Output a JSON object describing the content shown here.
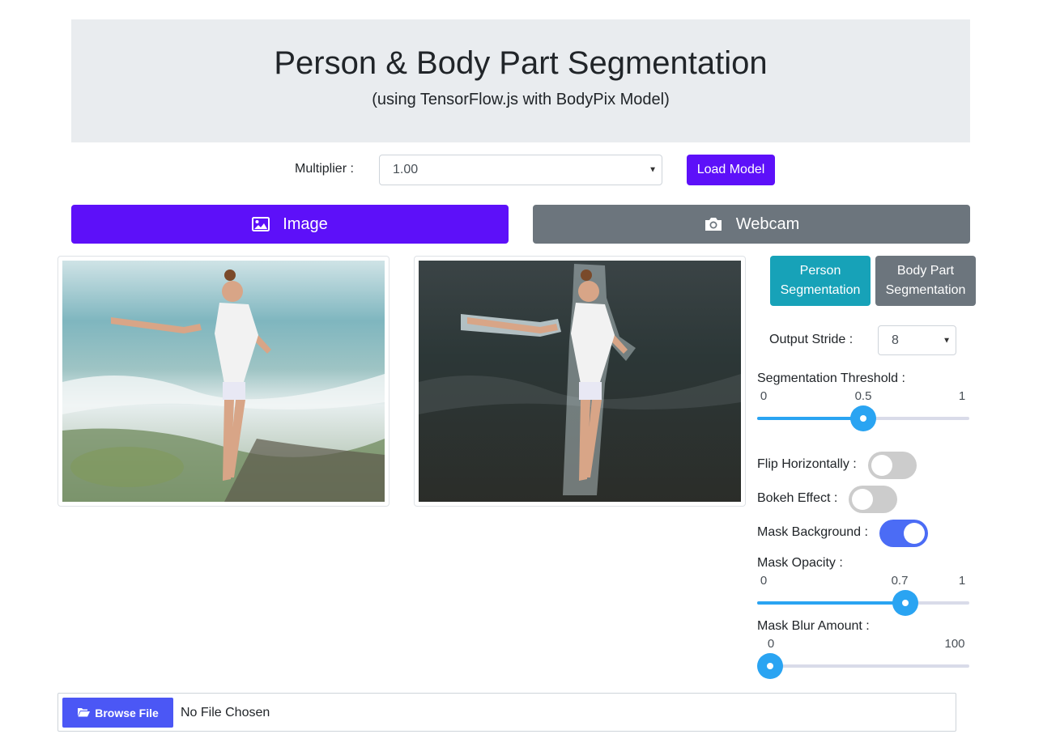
{
  "header": {
    "title": "Person & Body Part Segmentation",
    "subtitle": "(using TensorFlow.js with BodyPix Model)"
  },
  "model": {
    "multiplier_label": "Multiplier :",
    "multiplier_value": "1.00",
    "load_button": "Load Model"
  },
  "tabs": [
    {
      "label": "Image",
      "icon": "image-icon",
      "active": true
    },
    {
      "label": "Webcam",
      "icon": "camera-icon",
      "active": false
    }
  ],
  "segmentation_modes": {
    "person": "Person\nSegmentation",
    "body_part": "Body Part\nSegmentation",
    "selected": "person"
  },
  "controls": {
    "output_stride_label": "Output Stride :",
    "output_stride_value": "8",
    "threshold": {
      "label": "Segmentation Threshold :",
      "min": "0",
      "value": "0.5",
      "max": "1",
      "fraction": 0.5
    },
    "flip_label": "Flip Horizontally :",
    "flip_on": false,
    "bokeh_label": "Bokeh Effect :",
    "bokeh_on": false,
    "mask_bg_label": "Mask Background :",
    "mask_bg_on": true,
    "opacity": {
      "label": "Mask Opacity :",
      "min": "0",
      "value": "0.7",
      "max": "1",
      "fraction": 0.7
    },
    "blur": {
      "label": "Mask Blur Amount :",
      "value": "0",
      "max": "100",
      "fraction": 0
    }
  },
  "file_input": {
    "button_label": "Browse File",
    "file_name": "No File Chosen"
  },
  "colors": {
    "primary": "#5d10f9",
    "secondary": "#6c757d",
    "info": "#17a2b8",
    "slider": "#2aa4f2",
    "switch_on": "#4b6cf5",
    "browse": "#4b57f5"
  }
}
